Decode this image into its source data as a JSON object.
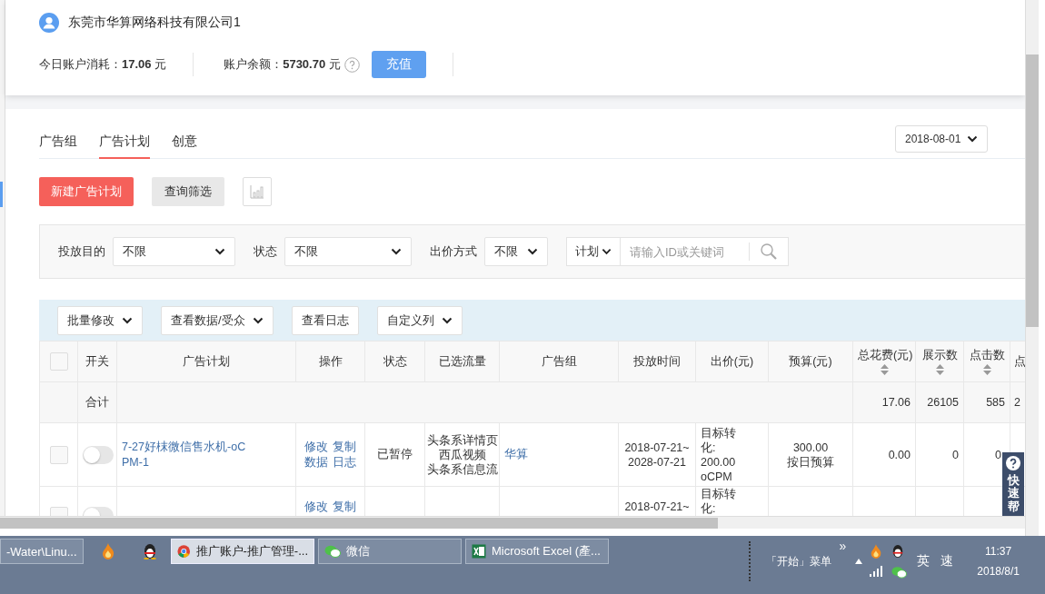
{
  "account": {
    "name": "东莞市华算网络科技有限公司1",
    "stats": [
      {
        "text": "今日账户消耗：**17.06** 元",
        "help": false
      },
      {
        "text": "账户余额：**5730.70** 元",
        "help": true
      }
    ],
    "recharge_button": "充值"
  },
  "tabs": [
    {
      "label": "广告组",
      "selected": false
    },
    {
      "label": "广告计划",
      "selected": true
    },
    {
      "label": "创意",
      "selected": false
    }
  ],
  "date_select": "2018-08-01",
  "actions": {
    "create_button": "新建广告计划",
    "filter_button": "查询筛选"
  },
  "filters": [
    {
      "label": "投放目的",
      "value": "不限"
    },
    {
      "label": "状态",
      "value": "不限"
    },
    {
      "label": "出价方式",
      "value": "不限"
    }
  ],
  "search": {
    "scope": "计划",
    "placeholder": "请输入ID或关键词"
  },
  "table_toolbar": [
    {
      "label": "批量修改",
      "dropdown": true
    },
    {
      "label": "查看数据/受众",
      "dropdown": true
    },
    {
      "label": "查看日志",
      "dropdown": false
    },
    {
      "label": "自定义列",
      "dropdown": true
    }
  ],
  "table": {
    "header_checked": false,
    "columns": [
      {
        "label": "开关",
        "sortable": false
      },
      {
        "label": "广告计划",
        "sortable": false
      },
      {
        "label": "操作",
        "sortable": false
      },
      {
        "label": "状态",
        "sortable": false
      },
      {
        "label": "已选流量",
        "sortable": false
      },
      {
        "label": "广告组",
        "sortable": false
      },
      {
        "label": "投放时间",
        "sortable": false
      },
      {
        "label": "出价(元)",
        "sortable": false
      },
      {
        "label": "预算(元)",
        "sortable": false
      },
      {
        "label": "总花费(元)",
        "sortable": true
      },
      {
        "label": "展示数",
        "sortable": true
      },
      {
        "label": "点击数",
        "sortable": true
      },
      {
        "label": "点",
        "sortable": false
      }
    ],
    "total_row": {
      "label": "合计",
      "values": [
        "17.06",
        "26105",
        "585",
        "2"
      ]
    },
    "rows": [
      {
        "checked": false,
        "on": false,
        "name": "7-27好枺微信售水机-oCPM-1",
        "operations": [
          "修改",
          "复制",
          "数据",
          "日志"
        ],
        "status": "已暂停",
        "traffic": [
          "头条系详情页",
          "西瓜视频",
          "头条系信息流"
        ],
        "group": "华算",
        "time": [
          "2018-07-21~",
          "2028-07-21"
        ],
        "bid": [
          "目标转化:",
          "200.00",
          "oCPM"
        ],
        "budget": [
          "300.00",
          "按日预算"
        ],
        "cost": "0.00",
        "impressions": "0",
        "clicks": "0"
      },
      {
        "checked": false,
        "on": false,
        "operations": [
          "修改",
          "复制"
        ],
        "time": [
          "2018-07-21~"
        ],
        "bid": [
          "目标转化:"
        ]
      }
    ]
  },
  "help_tab": "快速帮",
  "taskbar": {
    "items": [
      {
        "label": "-Water\\Linu...",
        "kind": "window",
        "selected": false
      },
      {
        "kind": "flame",
        "selected": false
      },
      {
        "kind": "qq",
        "selected": false
      },
      {
        "label": "推广账户-推广管理-...",
        "kind": "chrome",
        "selected": true
      },
      {
        "label": "微信",
        "kind": "wechat",
        "selected": false
      },
      {
        "label": "Microsoft Excel (產...",
        "kind": "excel",
        "selected": false
      }
    ],
    "start_menu": "「开始」菜单",
    "expand": "»",
    "ime": [
      "英",
      "速"
    ],
    "time": "11:37",
    "date": "2018/8/1"
  }
}
